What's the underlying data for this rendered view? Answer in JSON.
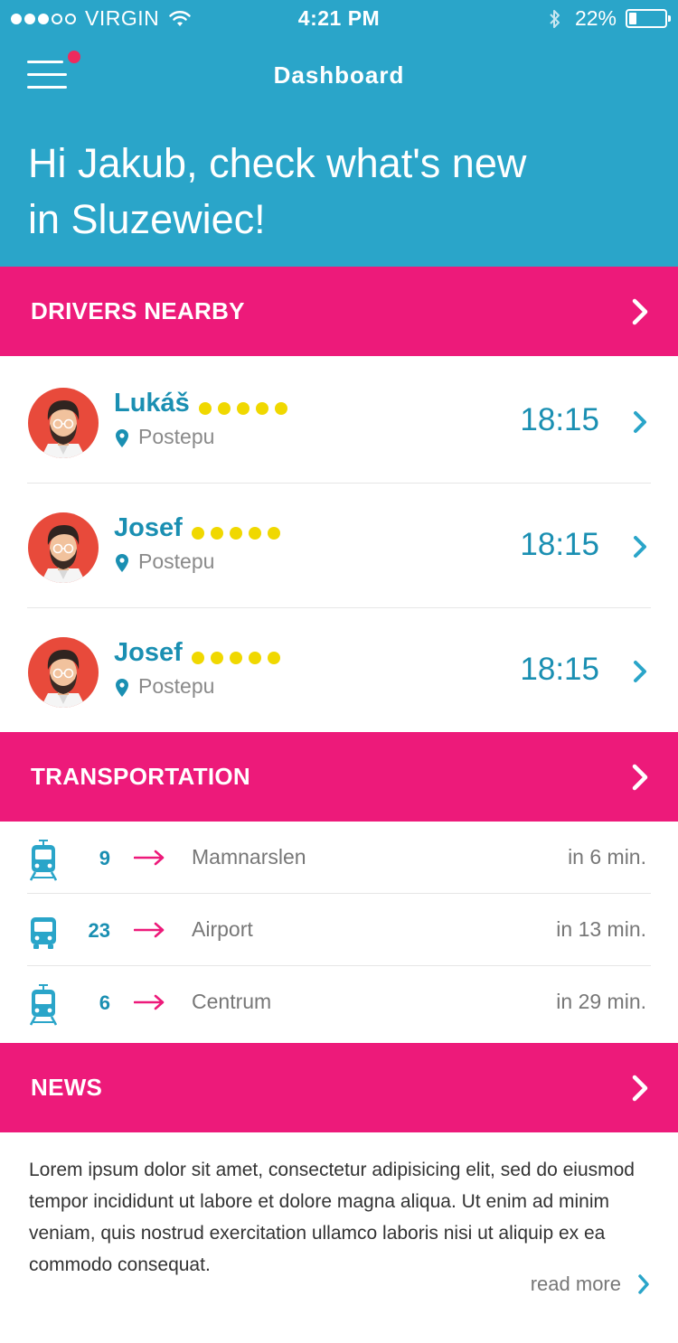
{
  "status_bar": {
    "carrier": "VIRGIN",
    "time": "4:21 PM",
    "battery": "22%",
    "battery_level": 0.22,
    "signal_bars_filled": 3,
    "signal_bars_total": 5
  },
  "header": {
    "title": "Dashboard",
    "greeting": "Hi Jakub, check what's new in Sluzewiec!",
    "background_color": "#2aa5c9",
    "has_notification_badge": true
  },
  "sections": {
    "drivers": "DRIVERS NEARBY",
    "transportation": "TRANSPORTATION",
    "news": "NEWS"
  },
  "drivers": [
    {
      "name": "Lukáš",
      "location": "Postepu",
      "time": "18:15",
      "rating": 5
    },
    {
      "name": "Josef",
      "location": "Postepu",
      "time": "18:15",
      "rating": 5
    },
    {
      "name": "Josef",
      "location": "Postepu",
      "time": "18:15",
      "rating": 5
    }
  ],
  "transportation": [
    {
      "type": "tram",
      "icon": "tram-icon",
      "number": "9",
      "destination": "Mamnarslen",
      "eta": "in 6 min."
    },
    {
      "type": "bus",
      "icon": "bus-icon",
      "number": "23",
      "destination": "Airport",
      "eta": "in 13 min."
    },
    {
      "type": "tram",
      "icon": "tram-icon",
      "number": "6",
      "destination": "Centrum",
      "eta": "in 29 min."
    }
  ],
  "news": {
    "body": "Lorem ipsum dolor sit amet, consectetur adipisicing elit, sed do eiusmod tempor incididunt ut labore et dolore magna aliqua. Ut enim ad minim veniam, quis nostrud exercitation ullamco laboris nisi ut aliquip ex ea commodo consequat.",
    "read_more": "read more"
  },
  "colors": {
    "primary": "#2aa5c9",
    "accent": "#ed1a7a",
    "text_blue": "#1a8fb2",
    "star": "#f0d800"
  }
}
